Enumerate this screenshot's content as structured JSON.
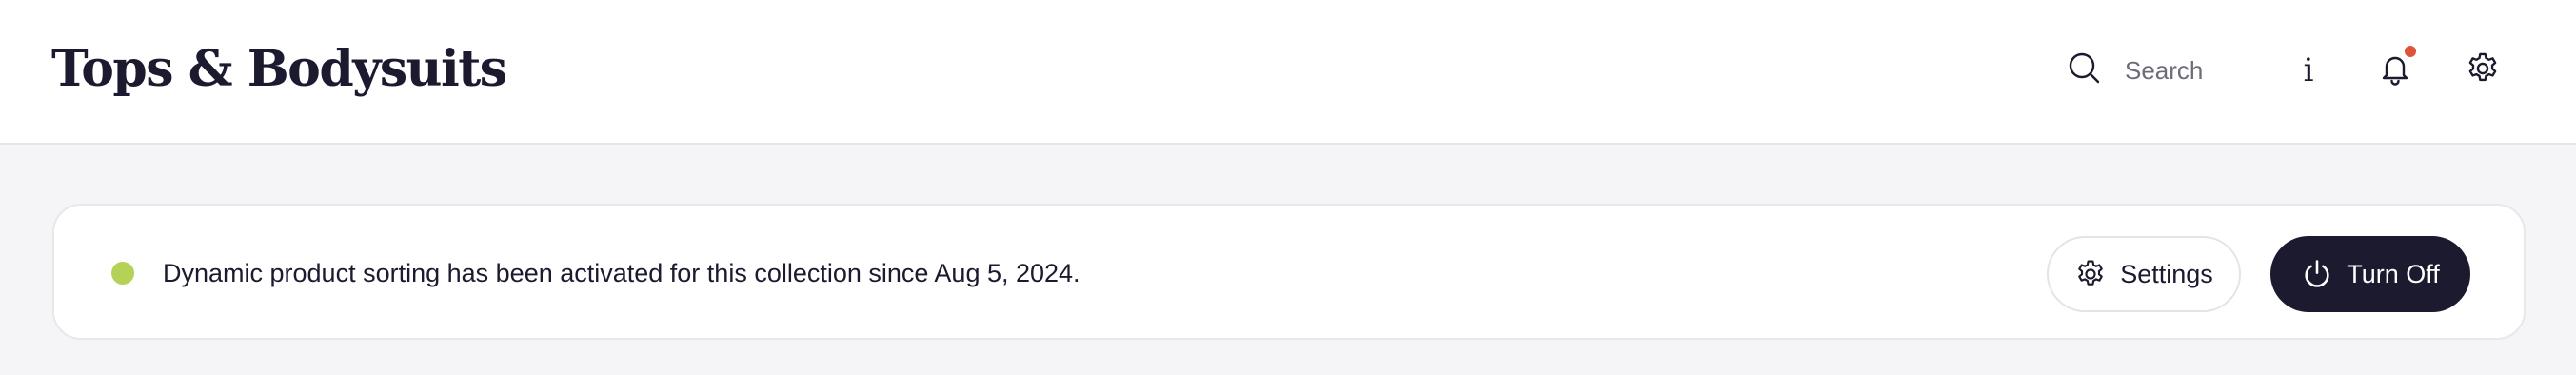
{
  "header": {
    "title": "Tops & Bodysuits",
    "search": {
      "placeholder": "Search",
      "value": "",
      "icon": "search-icon"
    },
    "actions": [
      {
        "name": "info",
        "icon": "info-icon",
        "glyph": "i"
      },
      {
        "name": "notifications",
        "icon": "bell-icon",
        "has_unread": true
      },
      {
        "name": "settings",
        "icon": "gear-icon"
      }
    ]
  },
  "banner": {
    "status": "active",
    "status_color": "#b5d257",
    "message": "Dynamic product sorting has been activated for this collection since Aug 5, 2024.",
    "settings_button": {
      "label": "Settings",
      "icon": "gear-icon"
    },
    "turn_off_button": {
      "label": "Turn Off",
      "icon": "power-icon"
    }
  },
  "colors": {
    "primary_dark": "#1b1a2e",
    "notification_dot": "#e0533b",
    "status_active": "#b5d257",
    "page_background": "#f5f5f7"
  }
}
